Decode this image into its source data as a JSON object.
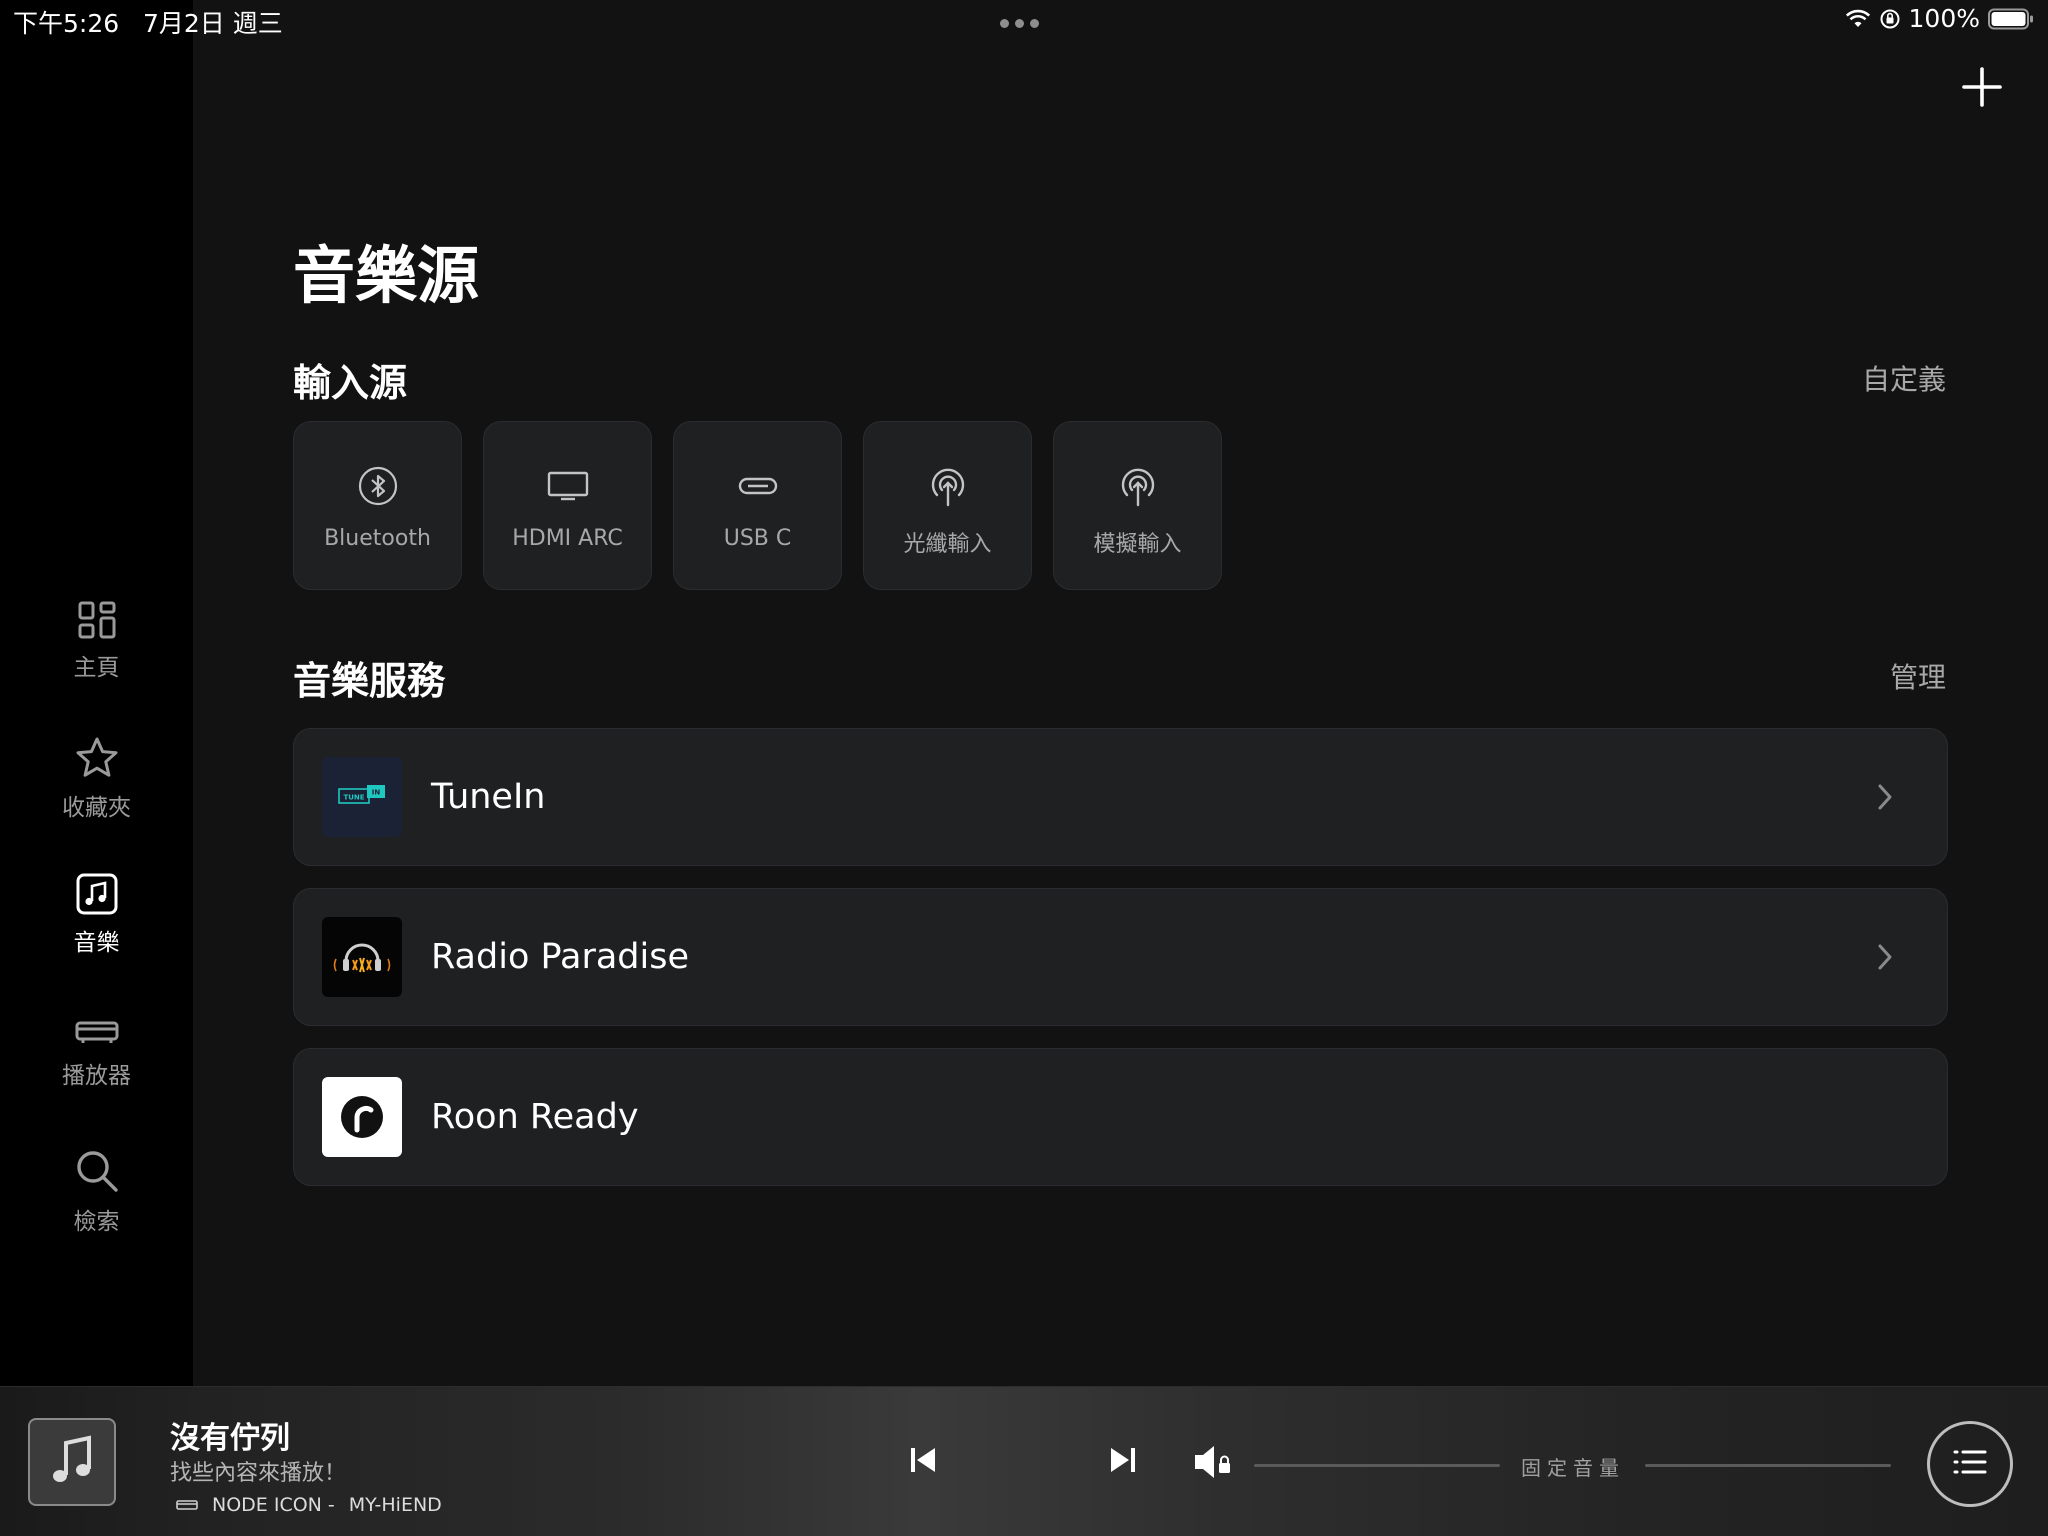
{
  "status": {
    "time": "下午5:26",
    "date": "7月2日 週三",
    "battery": "100%",
    "icons": [
      "wifi-icon",
      "orientation-lock-icon",
      "battery-icon"
    ]
  },
  "sidebar": {
    "items": [
      {
        "label": "主頁",
        "icon": "grid-icon",
        "active": false
      },
      {
        "label": "收藏夾",
        "icon": "star-icon",
        "active": false
      },
      {
        "label": "音樂",
        "icon": "music-note-icon",
        "active": true
      },
      {
        "label": "播放器",
        "icon": "player-device-icon",
        "active": false
      },
      {
        "label": "檢索",
        "icon": "search-icon",
        "active": false
      }
    ]
  },
  "main": {
    "title": "音樂源",
    "inputs": {
      "title": "輸入源",
      "action": "自定義",
      "tiles": [
        {
          "label": "Bluetooth",
          "icon": "bluetooth-icon"
        },
        {
          "label": "HDMI ARC",
          "icon": "tv-icon"
        },
        {
          "label": "USB C",
          "icon": "usb-c-icon"
        },
        {
          "label": "光纖輸入",
          "icon": "optical-input-icon"
        },
        {
          "label": "模擬輸入",
          "icon": "analog-input-icon"
        }
      ]
    },
    "services": {
      "title": "音樂服務",
      "action": "管理",
      "items": [
        {
          "name": "TuneIn",
          "logo_text": "TUNE IN",
          "chevron": true
        },
        {
          "name": "Radio Paradise",
          "chevron": true
        },
        {
          "name": "Roon Ready",
          "chevron": false
        }
      ]
    }
  },
  "player": {
    "title": "沒有佇列",
    "subtitle": "找些內容來播放！",
    "device_node": "NODE ICON -",
    "device_name": "MY-HiEND",
    "volume_label": "固定音量"
  }
}
